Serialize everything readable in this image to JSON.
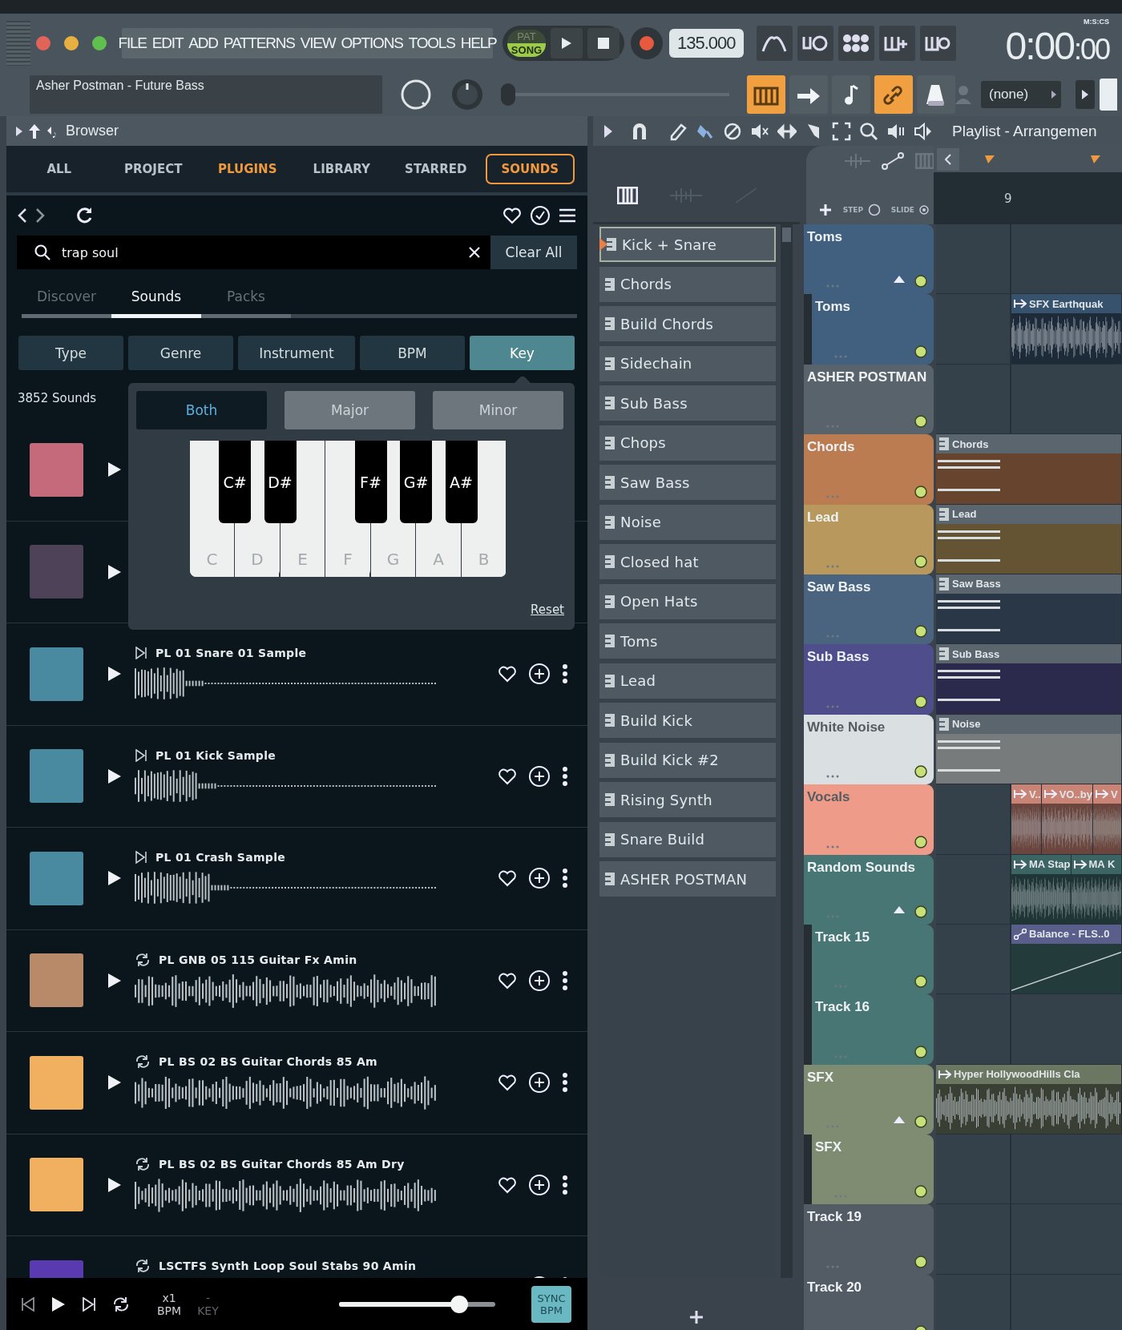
{
  "menu": [
    "FILE",
    "EDIT",
    "ADD",
    "PATTERNS",
    "VIEW",
    "OPTIONS",
    "TOOLS",
    "HELP"
  ],
  "transport": {
    "modes": [
      {
        "label": "PAT",
        "selected": false
      },
      {
        "label": "SONG",
        "selected": true
      }
    ],
    "tempo": "135.000",
    "time": "0:00",
    "time_fraction": ":00",
    "time_format": "M:S:CS"
  },
  "song_title": "Asher Postman - Future Bass",
  "toggles": [
    {
      "kind": "keyboard",
      "on": true
    },
    {
      "kind": "arrow",
      "on": false
    },
    {
      "kind": "note",
      "on": false
    },
    {
      "kind": "link",
      "on": true
    },
    {
      "kind": "metronome",
      "on": false
    }
  ],
  "pattern_selector": "(none)",
  "master_volume": {
    "level": 0.0
  },
  "browser": {
    "title": "Browser",
    "tabs": [
      {
        "label": "ALL",
        "selected": false,
        "highlighted": false
      },
      {
        "label": "PROJECT",
        "selected": false,
        "highlighted": false
      },
      {
        "label": "PLUGINS",
        "selected": false,
        "highlighted": true
      },
      {
        "label": "LIBRARY",
        "selected": false,
        "highlighted": false
      },
      {
        "label": "STARRED",
        "selected": false,
        "highlighted": false
      },
      {
        "label": "SOUNDS",
        "selected": true,
        "highlighted": true
      }
    ],
    "search": {
      "value": "trap soul"
    },
    "clear_all": "Clear All",
    "subtabs": [
      {
        "label": "Discover",
        "selected": false
      },
      {
        "label": "Sounds",
        "selected": true
      },
      {
        "label": "Packs",
        "selected": false
      }
    ],
    "filters": [
      {
        "label": "Type",
        "selected": false
      },
      {
        "label": "Genre",
        "selected": false
      },
      {
        "label": "Instrument",
        "selected": false
      },
      {
        "label": "BPM",
        "selected": false
      },
      {
        "label": "Key",
        "selected": true
      }
    ],
    "count": "3852 Sounds",
    "key_picker": {
      "modes": [
        {
          "label": "Both",
          "selected": true
        },
        {
          "label": "Major",
          "selected": false
        },
        {
          "label": "Minor",
          "selected": false
        }
      ],
      "white_keys": [
        "C",
        "D",
        "E",
        "F",
        "G",
        "A",
        "B"
      ],
      "black_keys": [
        "C#",
        "D#",
        "F#",
        "G#",
        "A#"
      ],
      "reset": "Reset"
    },
    "sounds": [
      {
        "color": "#c46a7a"
      },
      {
        "color": "#4e4258"
      },
      {
        "color": "#4a8aa0",
        "kind": "oneshot",
        "title": "PL 01 Snare 01 Sample"
      },
      {
        "color": "#4a8aa0",
        "kind": "oneshot",
        "title": "PL 01 Kick Sample"
      },
      {
        "color": "#4a8aa0",
        "kind": "oneshot",
        "title": "PL 01 Crash Sample"
      },
      {
        "color": "#b88a6a",
        "kind": "loop",
        "title": "PL GNB 05 115 Guitar Fx Amin"
      },
      {
        "color": "#f0b060",
        "kind": "loop",
        "title": "PL BS 02 BS Guitar Chords 85 Am"
      },
      {
        "color": "#f0b060",
        "kind": "loop",
        "title": "PL BS 02 BS Guitar Chords 85 Am Dry"
      },
      {
        "color": "#5a3ab0",
        "kind": "loop",
        "title": "LSCTFS Synth Loop Soul Stabs 90 Amin"
      }
    ],
    "player": {
      "speed": "x1",
      "speed_label": "BPM",
      "key": "-",
      "key_label": "KEY",
      "volume": {
        "level": 0.77
      },
      "sync": "SYNC BPM"
    }
  },
  "playlist": {
    "title": "Playlist - Arrangemen",
    "step_label": "STEP",
    "slide_label": "SLIDE",
    "bar": "9",
    "patterns": [
      {
        "name": "Kick + Snare",
        "selected": true
      },
      {
        "name": "Chords",
        "selected": false
      },
      {
        "name": "Build Chords",
        "selected": false
      },
      {
        "name": "Sidechain",
        "selected": false
      },
      {
        "name": "Sub Bass",
        "selected": false
      },
      {
        "name": "Chops",
        "selected": false
      },
      {
        "name": "Saw Bass",
        "selected": false
      },
      {
        "name": "Noise",
        "selected": false
      },
      {
        "name": "Closed hat",
        "selected": false
      },
      {
        "name": "Open Hats",
        "selected": false
      },
      {
        "name": "Toms",
        "selected": false
      },
      {
        "name": "Lead",
        "selected": false
      },
      {
        "name": "Build Kick",
        "selected": false
      },
      {
        "name": "Build Kick #2",
        "selected": false
      },
      {
        "name": "Rising Synth",
        "selected": false
      },
      {
        "name": "Snare Build",
        "selected": false
      },
      {
        "name": "ASHER POSTMAN",
        "selected": false
      }
    ],
    "tracks": [
      {
        "name": "Toms",
        "color": "#41607f",
        "children": [
          {
            "name": "Toms",
            "clips": [
              {
                "kind": "audio",
                "label": "SFX Earthquak",
                "starts_at_marker": true
              }
            ]
          }
        ]
      },
      {
        "name": "ASHER POSTMAN",
        "color": "#59636b"
      },
      {
        "name": "Chords",
        "color": "#bb7c52",
        "clips": [
          {
            "kind": "pattern",
            "label": "Chords",
            "starts_at_marker": false
          }
        ]
      },
      {
        "name": "Lead",
        "color": "#b8985c",
        "clips": [
          {
            "kind": "pattern",
            "label": "Lead",
            "starts_at_marker": false
          }
        ]
      },
      {
        "name": "Saw Bass",
        "color": "#4a6480",
        "clips": [
          {
            "kind": "pattern",
            "label": "Saw Bass",
            "starts_at_marker": false
          }
        ]
      },
      {
        "name": "Sub Bass",
        "color": "#4f4d8c",
        "clips": [
          {
            "kind": "pattern",
            "label": "Sub Bass",
            "starts_at_marker": false
          }
        ]
      },
      {
        "name": "White Noise",
        "color": "#dadfe1",
        "clips": [
          {
            "kind": "pattern",
            "label": "Noise",
            "starts_at_marker": false
          }
        ]
      },
      {
        "name": "Vocals",
        "color": "#ee9b8a",
        "clips": [
          {
            "kind": "audio",
            "label": "V..",
            "starts_at_marker": true
          },
          {
            "kind": "audio",
            "label": "VO..by",
            "starts_at_marker": false
          },
          {
            "kind": "audio",
            "label": "V",
            "starts_at_marker": false
          }
        ]
      },
      {
        "name": "Random Sounds",
        "color": "#477675",
        "clips": [
          {
            "kind": "audio",
            "label": "MA Stap",
            "starts_at_marker": true
          },
          {
            "kind": "audio",
            "label": "MA K",
            "starts_at_marker": false
          }
        ],
        "children": [
          {
            "name": "Track 15",
            "clips": [
              {
                "kind": "automation",
                "label": "Balance - FLS..0",
                "starts_at_marker": true
              }
            ]
          },
          {
            "name": "Track 16"
          }
        ]
      },
      {
        "name": "SFX",
        "color": "#7f8c72",
        "clips": [
          {
            "kind": "audio",
            "label": "Hyper HollywoodHills Cla",
            "starts_at_marker": false
          }
        ],
        "children": [
          {
            "name": "SFX"
          }
        ]
      },
      {
        "name": "Track 19",
        "color": "#535c65"
      },
      {
        "name": "Track 20",
        "color": "#535c65"
      }
    ]
  }
}
